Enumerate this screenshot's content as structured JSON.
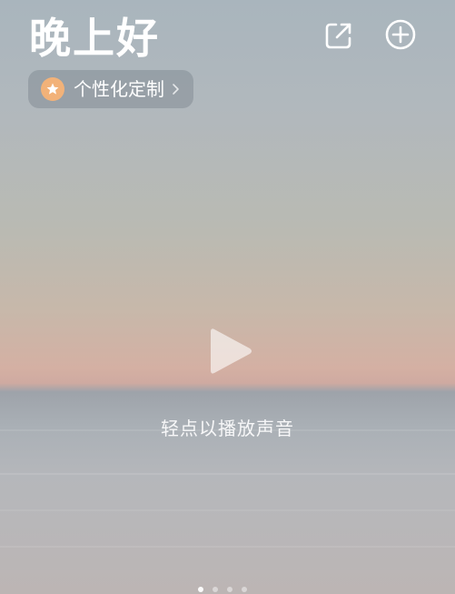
{
  "header": {
    "greeting": "晚上好",
    "share_icon": "share-icon",
    "add_icon": "plus-circle-icon"
  },
  "customize": {
    "label": "个性化定制",
    "badge_icon": "star-icon",
    "chevron_icon": "chevron-right-icon",
    "badge_color": "#f2b279"
  },
  "player": {
    "play_icon": "play-icon",
    "hint": "轻点以播放声音"
  },
  "pager": {
    "count": 4,
    "active_index": 0
  }
}
